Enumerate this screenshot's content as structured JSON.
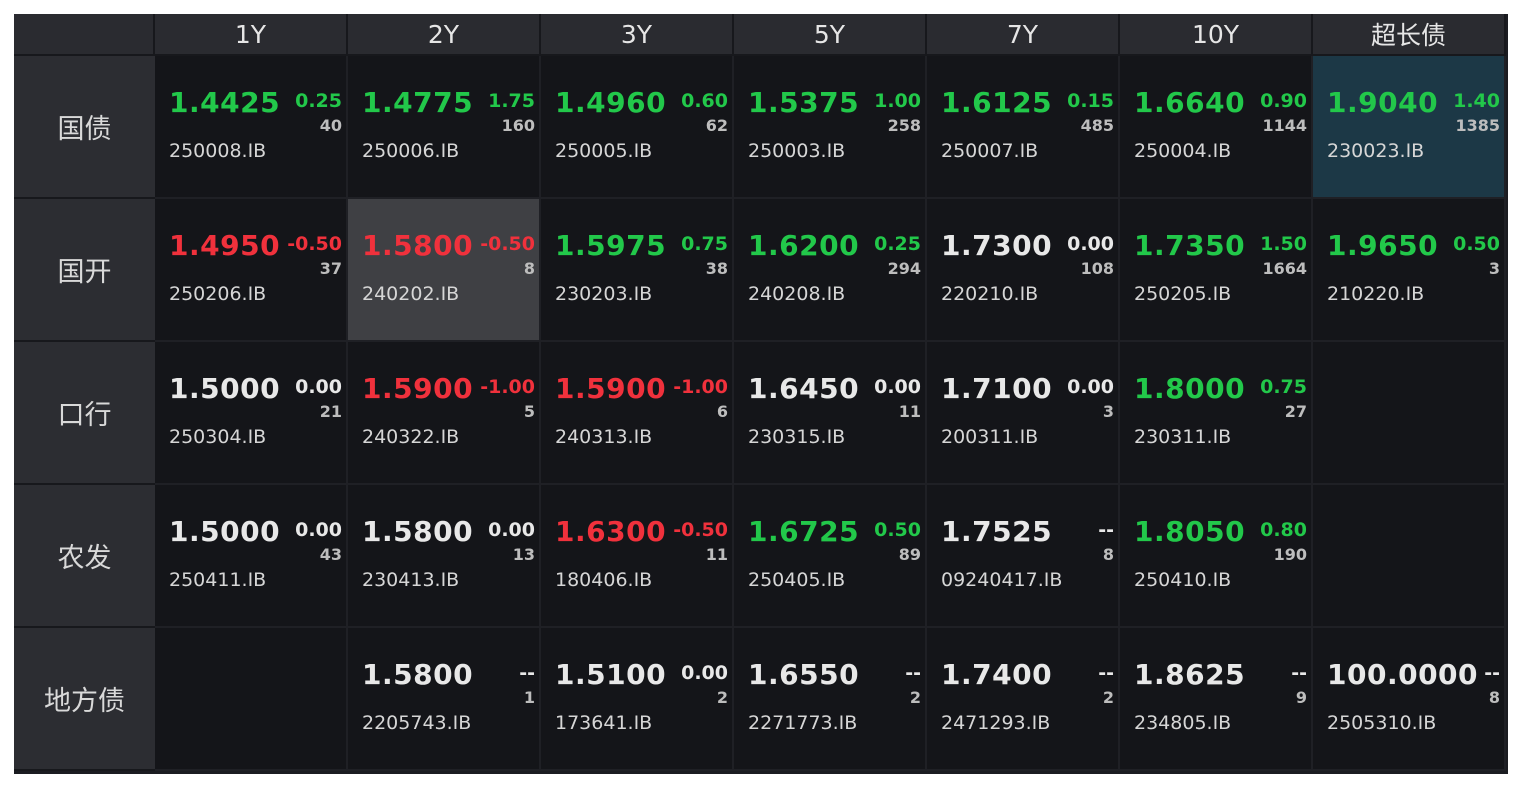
{
  "colors": {
    "up": "#22c84a",
    "down": "#f0313c",
    "flat": "#e8e8e8",
    "cell_bg": "#141519",
    "header_bg": "#2a2b30",
    "highlight_gray": "#3f4044",
    "highlight_teal": "#1c3846"
  },
  "columns": [
    "1Y",
    "2Y",
    "3Y",
    "5Y",
    "7Y",
    "10Y",
    "超长债"
  ],
  "rows": [
    {
      "label": "国债",
      "cells": [
        {
          "price": "1.4425",
          "change": "0.25",
          "volume": "40",
          "code": "250008.IB",
          "color": "green"
        },
        {
          "price": "1.4775",
          "change": "1.75",
          "volume": "160",
          "code": "250006.IB",
          "color": "green"
        },
        {
          "price": "1.4960",
          "change": "0.60",
          "volume": "62",
          "code": "250005.IB",
          "color": "green"
        },
        {
          "price": "1.5375",
          "change": "1.00",
          "volume": "258",
          "code": "250003.IB",
          "color": "green"
        },
        {
          "price": "1.6125",
          "change": "0.15",
          "volume": "485",
          "code": "250007.IB",
          "color": "green"
        },
        {
          "price": "1.6640",
          "change": "0.90",
          "volume": "1144",
          "code": "250004.IB",
          "color": "green"
        },
        {
          "price": "1.9040",
          "change": "1.40",
          "volume": "1385",
          "code": "230023.IB",
          "color": "green",
          "highlight": "teal"
        }
      ]
    },
    {
      "label": "国开",
      "cells": [
        {
          "price": "1.4950",
          "change": "-0.50",
          "volume": "37",
          "code": "250206.IB",
          "color": "red"
        },
        {
          "price": "1.5800",
          "change": "-0.50",
          "volume": "8",
          "code": "240202.IB",
          "color": "red",
          "highlight": "gray"
        },
        {
          "price": "1.5975",
          "change": "0.75",
          "volume": "38",
          "code": "230203.IB",
          "color": "green"
        },
        {
          "price": "1.6200",
          "change": "0.25",
          "volume": "294",
          "code": "240208.IB",
          "color": "green"
        },
        {
          "price": "1.7300",
          "change": "0.00",
          "volume": "108",
          "code": "220210.IB",
          "color": "white"
        },
        {
          "price": "1.7350",
          "change": "1.50",
          "volume": "1664",
          "code": "250205.IB",
          "color": "green"
        },
        {
          "price": "1.9650",
          "change": "0.50",
          "volume": "3",
          "code": "210220.IB",
          "color": "green"
        }
      ]
    },
    {
      "label": "口行",
      "cells": [
        {
          "price": "1.5000",
          "change": "0.00",
          "volume": "21",
          "code": "250304.IB",
          "color": "white"
        },
        {
          "price": "1.5900",
          "change": "-1.00",
          "volume": "5",
          "code": "240322.IB",
          "color": "red"
        },
        {
          "price": "1.5900",
          "change": "-1.00",
          "volume": "6",
          "code": "240313.IB",
          "color": "red"
        },
        {
          "price": "1.6450",
          "change": "0.00",
          "volume": "11",
          "code": "230315.IB",
          "color": "white"
        },
        {
          "price": "1.7100",
          "change": "0.00",
          "volume": "3",
          "code": "200311.IB",
          "color": "white"
        },
        {
          "price": "1.8000",
          "change": "0.75",
          "volume": "27",
          "code": "230311.IB",
          "color": "green"
        },
        null
      ]
    },
    {
      "label": "农发",
      "cells": [
        {
          "price": "1.5000",
          "change": "0.00",
          "volume": "43",
          "code": "250411.IB",
          "color": "white"
        },
        {
          "price": "1.5800",
          "change": "0.00",
          "volume": "13",
          "code": "230413.IB",
          "color": "white"
        },
        {
          "price": "1.6300",
          "change": "-0.50",
          "volume": "11",
          "code": "180406.IB",
          "color": "red"
        },
        {
          "price": "1.6725",
          "change": "0.50",
          "volume": "89",
          "code": "250405.IB",
          "color": "green"
        },
        {
          "price": "1.7525",
          "change": "--",
          "volume": "8",
          "code": "09240417.IB",
          "color": "white"
        },
        {
          "price": "1.8050",
          "change": "0.80",
          "volume": "190",
          "code": "250410.IB",
          "color": "green"
        },
        null
      ]
    },
    {
      "label": "地方债",
      "cells": [
        null,
        {
          "price": "1.5800",
          "change": "--",
          "volume": "1",
          "code": "2205743.IB",
          "color": "white"
        },
        {
          "price": "1.5100",
          "change": "0.00",
          "volume": "2",
          "code": "173641.IB",
          "color": "white"
        },
        {
          "price": "1.6550",
          "change": "--",
          "volume": "2",
          "code": "2271773.IB",
          "color": "white"
        },
        {
          "price": "1.7400",
          "change": "--",
          "volume": "2",
          "code": "2471293.IB",
          "color": "white"
        },
        {
          "price": "1.8625",
          "change": "--",
          "volume": "9",
          "code": "234805.IB",
          "color": "white"
        },
        {
          "price": "100.0000",
          "change": "--",
          "volume": "8",
          "code": "2505310.IB",
          "color": "white"
        }
      ]
    }
  ]
}
